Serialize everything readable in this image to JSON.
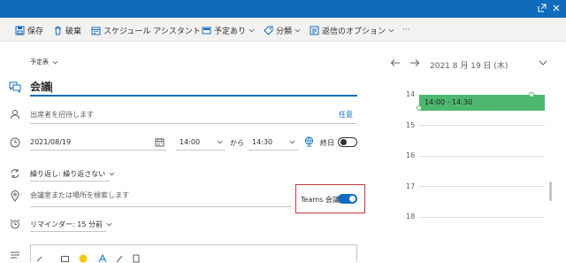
{
  "colors": {
    "accent": "#0f6cbd",
    "event": "#4cb86f",
    "highlight": "#d13438"
  },
  "toolbar": {
    "save": "保存",
    "discard": "破棄",
    "scheduling": "スケジュール アシスタント",
    "busy": "予定あり",
    "categorize": "分類",
    "response_options": "返信のオプション",
    "more": "···"
  },
  "form": {
    "calendar": "予定表",
    "title": "会議",
    "attendees_placeholder": "出席者を招待します",
    "optional": "任意",
    "start_date": "2021/08/19",
    "start_time": "14:00",
    "to": "から",
    "end_time": "14:30",
    "all_day": "終日",
    "repeat": "繰り返し: 繰り返さない",
    "location_placeholder": "会議室または場所を検索します",
    "teams_label": "Teams 会議",
    "reminder": "リマインダー: 15 分前"
  },
  "calendar": {
    "date": "2021 8 月 19 日 (木)",
    "hours": [
      "14",
      "15",
      "16",
      "17",
      "18"
    ],
    "event": "14:00 - 14:30"
  }
}
